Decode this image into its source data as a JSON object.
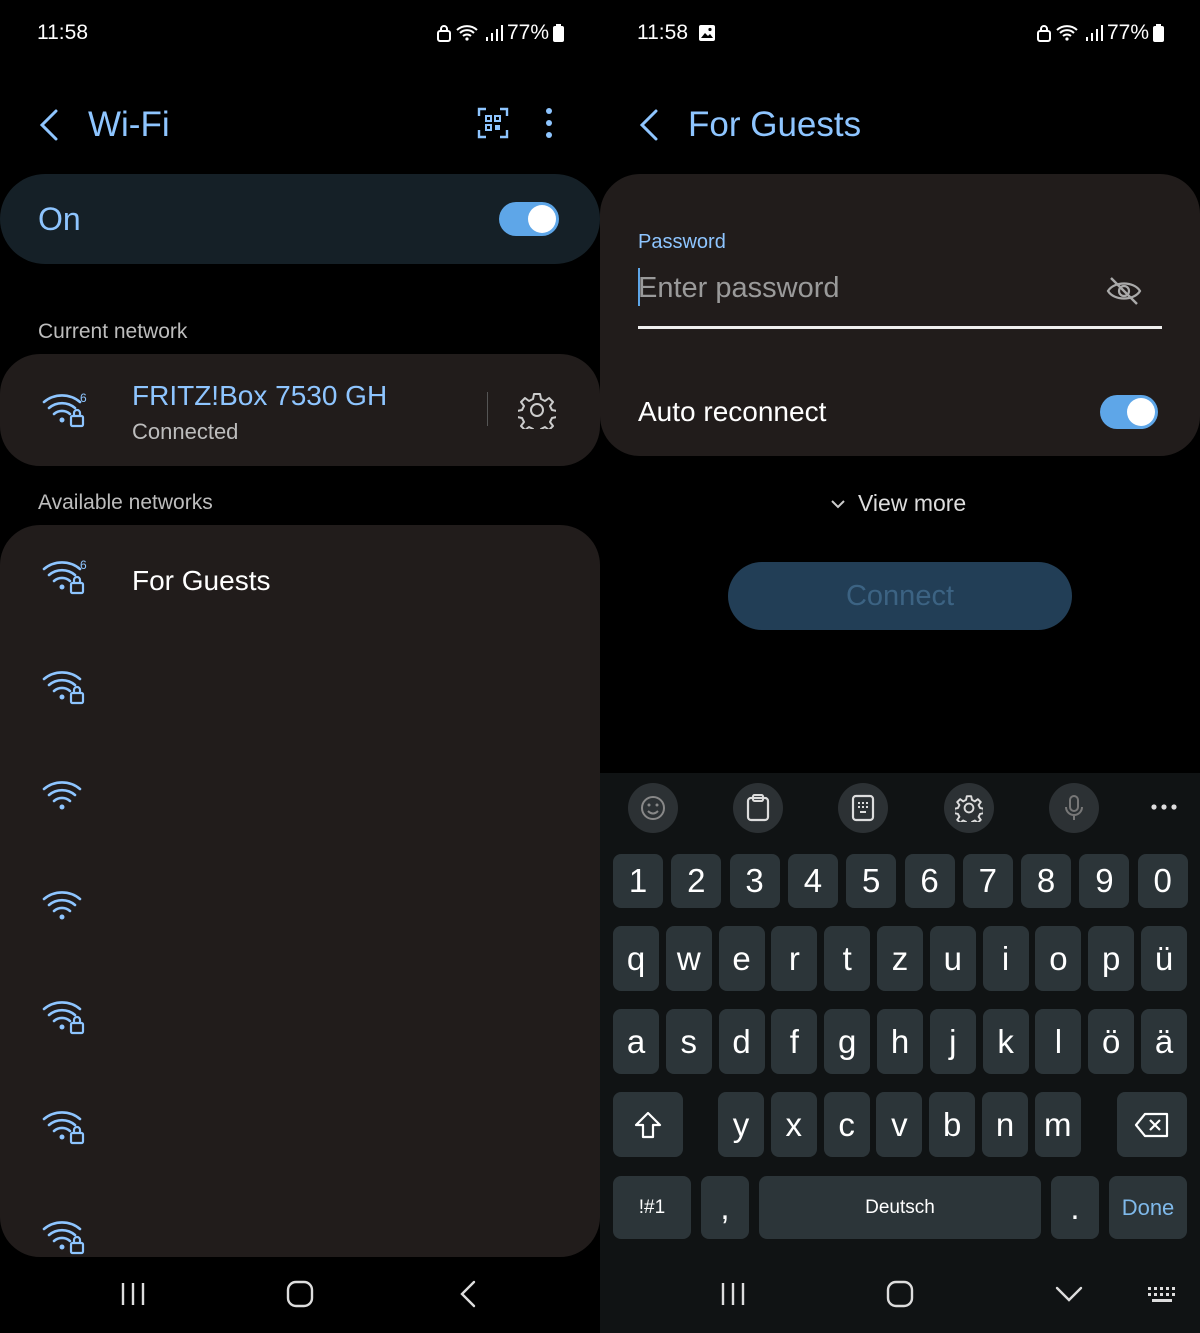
{
  "left": {
    "status": {
      "time": "11:58",
      "battery": "77%"
    },
    "title": "Wi-Fi",
    "toggle_label": "On",
    "current_network_label": "Current network",
    "current_network": {
      "name": "FRITZ!Box 7530 GH",
      "status": "Connected"
    },
    "available_label": "Available networks",
    "available_networks": [
      {
        "name": "For Guests",
        "icon": "wifi-6-lock-icon"
      },
      {
        "name": "",
        "icon": "wifi-lock-icon"
      },
      {
        "name": "",
        "icon": "wifi-icon"
      },
      {
        "name": "",
        "icon": "wifi-icon"
      },
      {
        "name": "",
        "icon": "wifi-lock-icon"
      },
      {
        "name": "",
        "icon": "wifi-lock-icon"
      },
      {
        "name": "",
        "icon": "wifi-lock-icon"
      }
    ]
  },
  "right": {
    "status": {
      "time": "11:58",
      "battery": "77%"
    },
    "title": "For Guests",
    "password_label": "Password",
    "password_placeholder": "Enter password",
    "auto_reconnect_label": "Auto reconnect",
    "view_more": "View more",
    "connect": "Connect",
    "keyboard": {
      "row_numbers": [
        "1",
        "2",
        "3",
        "4",
        "5",
        "6",
        "7",
        "8",
        "9",
        "0"
      ],
      "row1": [
        "q",
        "w",
        "e",
        "r",
        "t",
        "z",
        "u",
        "i",
        "o",
        "p",
        "ü"
      ],
      "row2": [
        "a",
        "s",
        "d",
        "f",
        "g",
        "h",
        "j",
        "k",
        "l",
        "ö",
        "ä"
      ],
      "row3": [
        "y",
        "x",
        "c",
        "v",
        "b",
        "n",
        "m"
      ],
      "symbols": "!#1",
      "comma": ",",
      "space": "Deutsch",
      "period": ".",
      "done": "Done"
    }
  },
  "colors": {
    "accent": "#8ec5ff",
    "toggle": "#5ea6e8",
    "card": "#211c1b",
    "key": "#2c3539"
  }
}
